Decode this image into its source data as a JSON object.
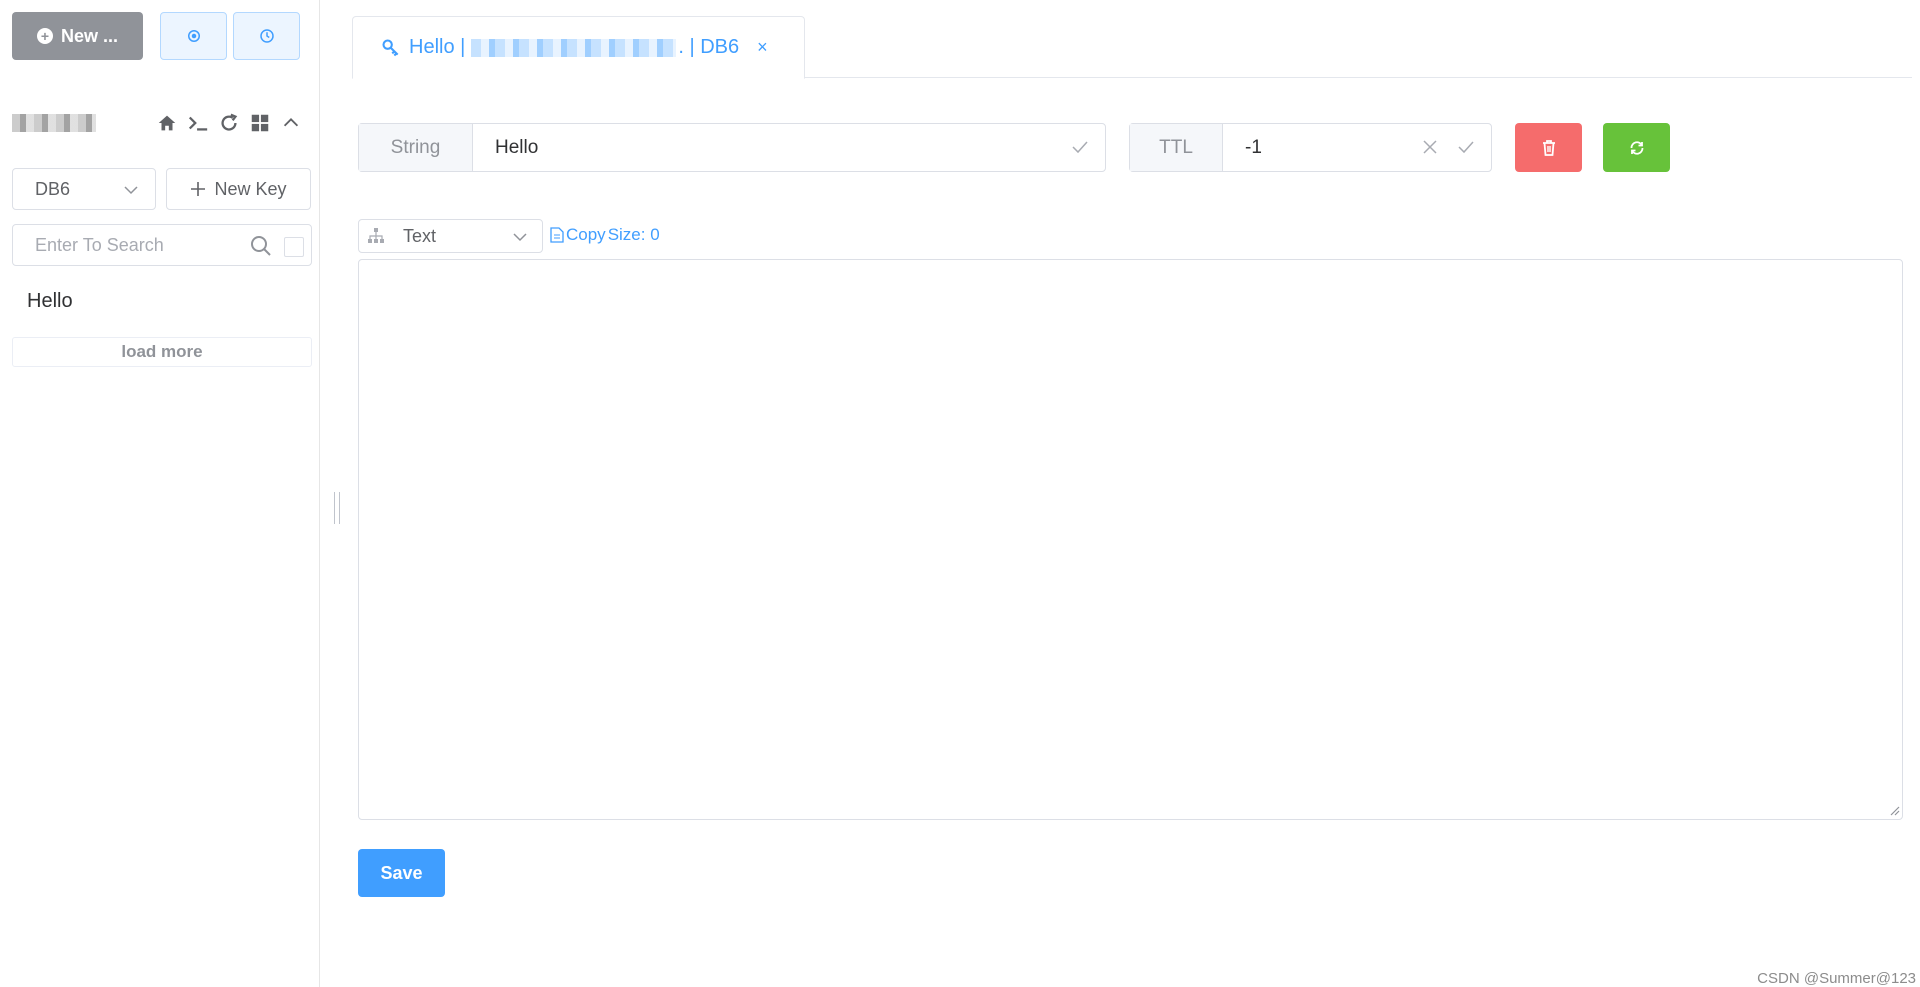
{
  "sidebar": {
    "new_connection_label": "New ...",
    "db_select": {
      "value": "DB6"
    },
    "new_key_label": "New Key",
    "search": {
      "placeholder": "Enter To Search"
    },
    "keys": [
      "Hello"
    ],
    "load_more_label": "load more",
    "connection_icons": [
      "home-icon",
      "terminal-icon",
      "refresh-icon",
      "grid-icon",
      "chevron-up-icon"
    ]
  },
  "tab": {
    "label_prefix": "Hello |",
    "label_suffix": ". | DB6",
    "close_symbol": "×"
  },
  "key_detail": {
    "type_label": "String",
    "key_name": "Hello",
    "ttl_label": "TTL",
    "ttl_value": "-1"
  },
  "value_panel": {
    "format": "Text",
    "copy_label": "Copy",
    "size_label": "Size: 0",
    "value": ""
  },
  "save_label": "Save",
  "watermark": "CSDN @Summer@123",
  "colors": {
    "primary": "#409eff",
    "danger": "#f56c6c",
    "success": "#67c23a",
    "info": "#909399"
  }
}
